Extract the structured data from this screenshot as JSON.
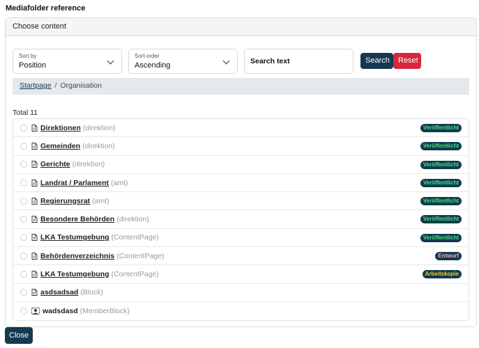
{
  "title": "Mediafolder reference",
  "card": {
    "header": "Choose content"
  },
  "filters": {
    "sort_by": {
      "label": "Sort by",
      "value": "Position"
    },
    "sort_order": {
      "label": "Sort order",
      "value": "Ascending"
    },
    "search": {
      "value": "Search text",
      "placeholder": "Search text"
    },
    "search_button": "Search",
    "reset_button": "Reset"
  },
  "breadcrumb": {
    "root": "Startpage",
    "separator": "/",
    "current": "Organisation"
  },
  "total_label": "Total 11",
  "status_colors": {
    "Veröffentlicht": "#4ade80",
    "Entwurf": "#f9a8c8",
    "Arbeitskopie": "#facc15"
  },
  "items": [
    {
      "name": "Direktionen",
      "type": "(direktion)",
      "icon": "page-icon",
      "status": "Veröffentlicht"
    },
    {
      "name": "Gemeinden",
      "type": "(direktion)",
      "icon": "page-icon",
      "status": "Veröffentlicht"
    },
    {
      "name": "Gerichte",
      "type": "(direktion)",
      "icon": "page-icon",
      "status": "Veröffentlicht"
    },
    {
      "name": "Landrat / Parlament",
      "type": "(amt)",
      "icon": "page-icon",
      "status": "Veröffentlicht"
    },
    {
      "name": "Regierungsrat",
      "type": "(amt)",
      "icon": "page-icon",
      "status": "Veröffentlicht"
    },
    {
      "name": "Besondere Behörden",
      "type": "(direktion)",
      "icon": "page-icon",
      "status": "Veröffentlicht"
    },
    {
      "name": "LKA Testumgebung",
      "type": "(ContentPage)",
      "icon": "page-icon",
      "status": "Veröffentlicht"
    },
    {
      "name": "Behördenverzeichnis",
      "type": "(ContentPage)",
      "icon": "page-icon",
      "status": "Entwurf"
    },
    {
      "name": "LKA Testumgebung",
      "type": "(ContentPage)",
      "icon": "page-icon",
      "status": "Arbeitskopie"
    },
    {
      "name": "asdsadsad",
      "type": "(Block)",
      "icon": "page-icon",
      "status": ""
    },
    {
      "name": "wadsdasd",
      "type": "(MemberBlock)",
      "icon": "member-icon",
      "status": ""
    }
  ],
  "close_button": "Close"
}
